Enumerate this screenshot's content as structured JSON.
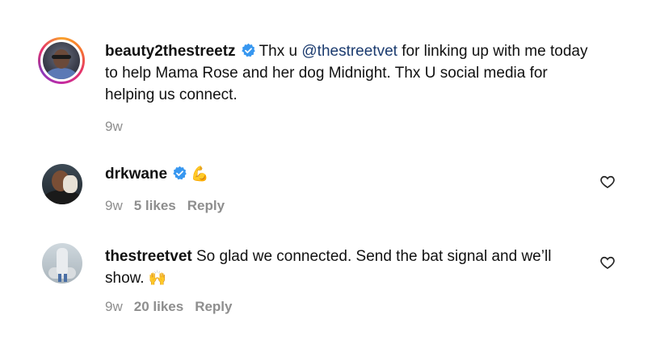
{
  "comments": [
    {
      "username": "beauty2thestreetz",
      "verified": true,
      "text_before": "Thx u ",
      "mention": "@thestreetvet",
      "text_after": " for linking up with me today to help Mama Rose and her dog Midnight. Thx U social media for helping us connect.",
      "time": "9w"
    },
    {
      "username": "drkwane",
      "verified": true,
      "emoji": "💪",
      "time": "9w",
      "likes": "5 likes",
      "reply": "Reply"
    },
    {
      "username": "thestreetvet",
      "verified": false,
      "text": "So glad we connected. Send the bat signal and we’ll show.",
      "emoji": "🙌",
      "time": "9w",
      "likes": "20 likes",
      "reply": "Reply"
    }
  ],
  "colors": {
    "verified": "#3797f0",
    "mention": "#1b3b6f",
    "meta": "#8e8e8e"
  }
}
